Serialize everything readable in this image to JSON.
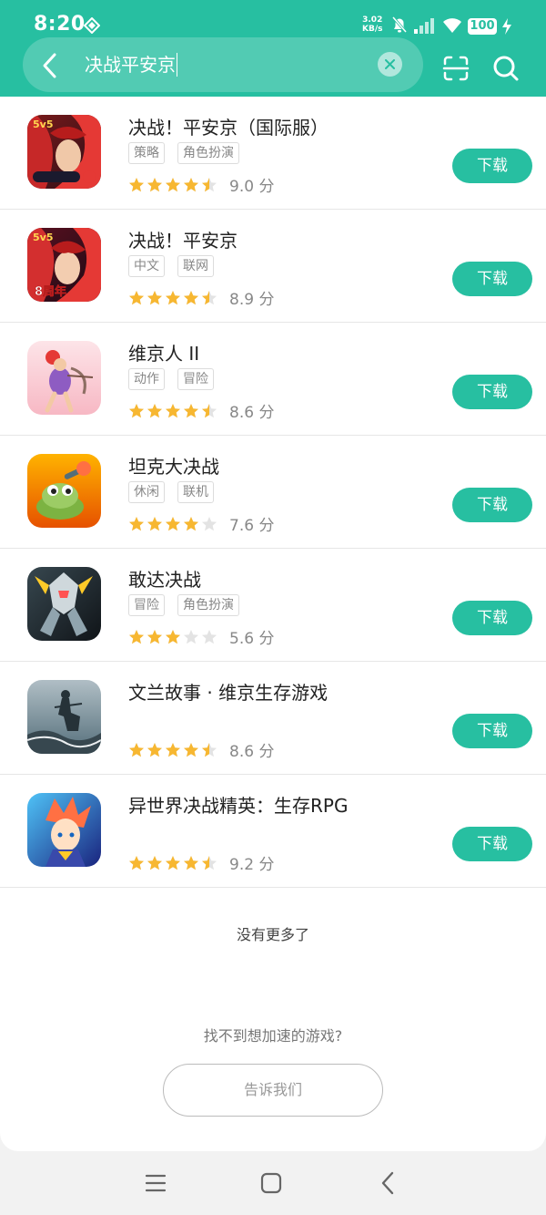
{
  "status_bar": {
    "time": "8:20",
    "net_speed_value": "3.02",
    "net_speed_unit": "KB/s",
    "battery": "100"
  },
  "search": {
    "query": "决战平安京"
  },
  "results": [
    {
      "name": "决战！平安京（国际服）",
      "tags": [
        "策略",
        "角色扮演"
      ],
      "rating": 4.5,
      "score": "9.0 分",
      "download": "下载"
    },
    {
      "name": "决战！平安京",
      "tags": [
        "中文",
        "联网"
      ],
      "rating": 4.5,
      "score": "8.9 分",
      "download": "下载"
    },
    {
      "name": "维京人 II",
      "tags": [
        "动作",
        "冒险"
      ],
      "rating": 4.5,
      "score": "8.6 分",
      "download": "下载"
    },
    {
      "name": "坦克大决战",
      "tags": [
        "休闲",
        "联机"
      ],
      "rating": 4,
      "score": "7.6 分",
      "download": "下载"
    },
    {
      "name": "敢达决战",
      "tags": [
        "冒险",
        "角色扮演"
      ],
      "rating": 3,
      "score": "5.6 分",
      "download": "下载"
    },
    {
      "name": "文兰故事 · 维京生存游戏",
      "tags": [],
      "rating": 4.5,
      "score": "8.6 分",
      "download": "下载"
    },
    {
      "name": "异世界决战精英：生存RPG",
      "tags": [],
      "rating": 4.5,
      "score": "9.2 分",
      "download": "下载"
    }
  ],
  "footer": {
    "no_more": "没有更多了",
    "prompt": "找不到想加速的游戏?",
    "tell_us_button": "告诉我们"
  },
  "colors": {
    "accent": "#27bfa1",
    "star": "#f7b731",
    "star_empty": "#e3e3e3"
  },
  "icons": [
    "back-icon",
    "clear-icon",
    "scan-icon",
    "search-icon",
    "menu-icon",
    "home-icon",
    "nav-back-icon"
  ]
}
